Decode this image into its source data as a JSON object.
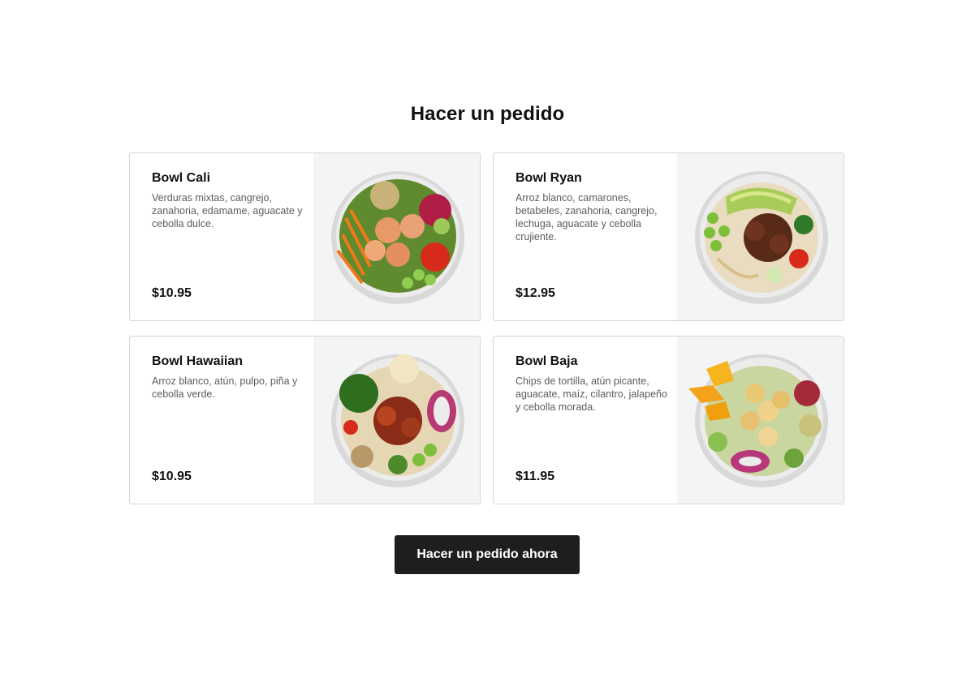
{
  "page": {
    "title": "Hacer un pedido"
  },
  "menu": {
    "items": [
      {
        "name": "Bowl Cali",
        "description": "Verduras mixtas, cangrejo, zanahoria, edamame, aguacate y cebolla dulce.",
        "price": "$10.95",
        "image": "bowl-cali-image"
      },
      {
        "name": "Bowl Ryan",
        "description": "Arroz blanco, camarones, betabeles, zanahoria, cangrejo, lechuga, aguacate y cebolla crujiente.",
        "price": "$12.95",
        "image": "bowl-ryan-image"
      },
      {
        "name": "Bowl Hawaiian",
        "description": "Arroz blanco, atún, pulpo, piña y cebolla verde.",
        "price": "$10.95",
        "image": "bowl-hawaiian-image"
      },
      {
        "name": "Bowl Baja",
        "description": "Chips de tortilla, atún picante, aguacate, maíz, cilantro, jalapeño y cebolla morada.",
        "price": "$11.95",
        "image": "bowl-baja-image"
      }
    ]
  },
  "cta": {
    "label": "Hacer un pedido ahora"
  },
  "colors": {
    "button_bg": "#1e1e1e",
    "image_panel_bg": "#f3f4f6",
    "card_border": "#d6d6d6"
  }
}
